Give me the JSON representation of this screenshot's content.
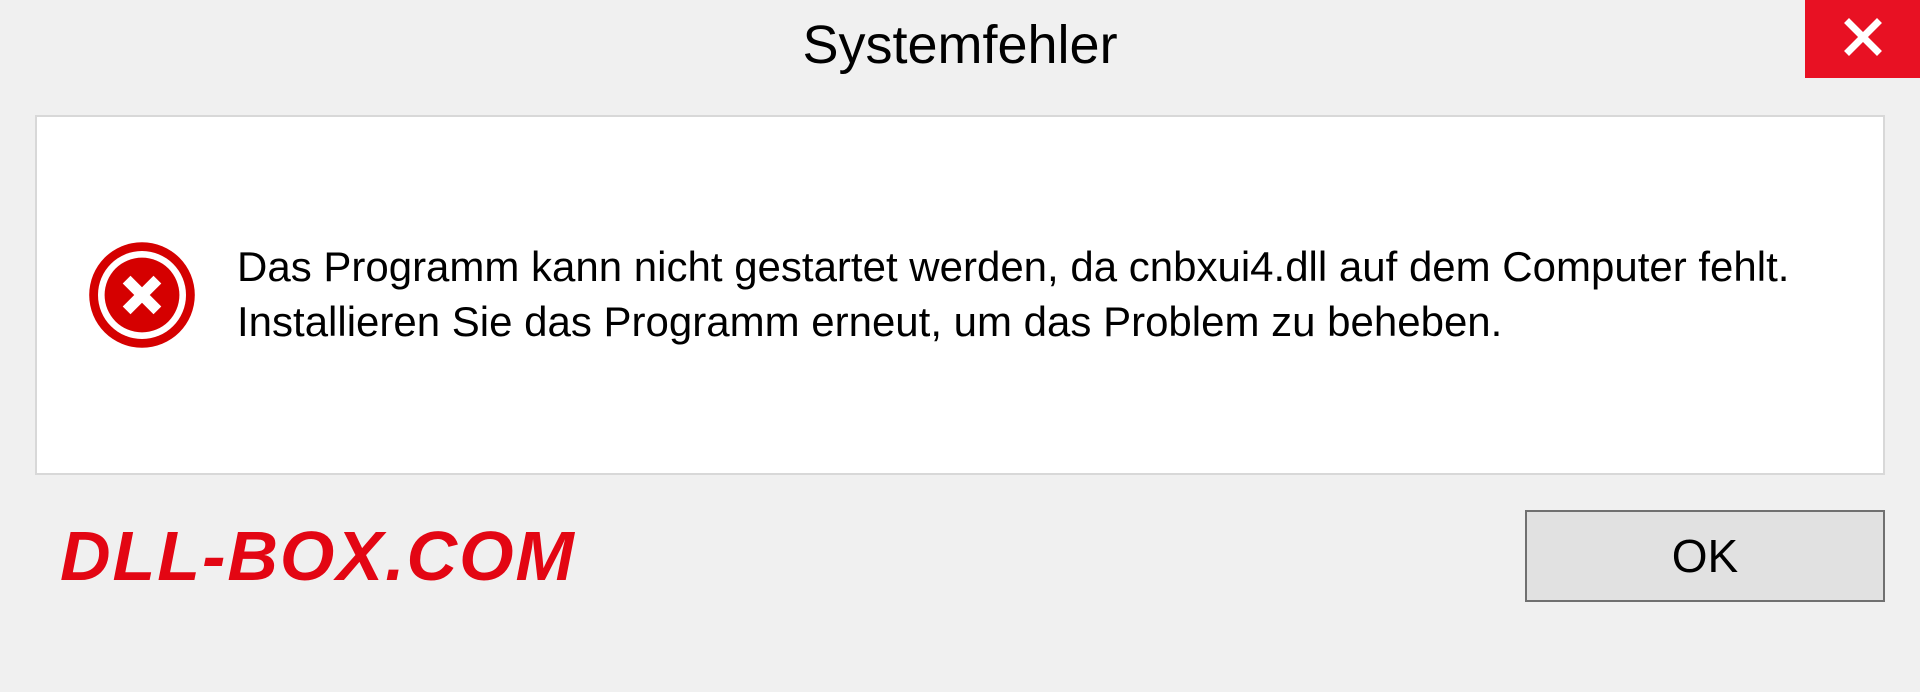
{
  "dialog": {
    "title": "Systemfehler",
    "message": "Das Programm kann nicht gestartet werden, da cnbxui4.dll auf dem Computer fehlt. Installieren Sie das Programm erneut, um das Problem zu beheben.",
    "ok_label": "OK"
  },
  "watermark": {
    "text": "DLL-BOX.COM"
  },
  "colors": {
    "close_bg": "#e81123",
    "error_icon": "#d50000",
    "watermark": "#e30613"
  }
}
